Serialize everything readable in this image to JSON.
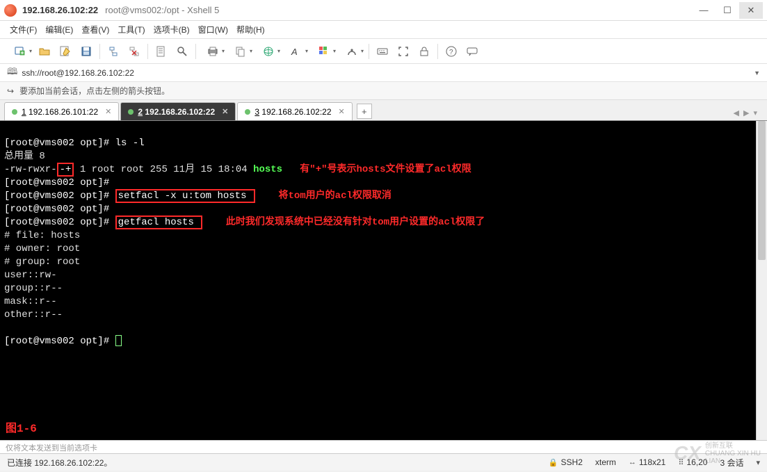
{
  "title": {
    "host": "192.168.26.102:22",
    "rest": "root@vms002:/opt - Xshell 5"
  },
  "menu": {
    "file": "文件(F)",
    "edit": "编辑(E)",
    "view": "查看(V)",
    "tools": "工具(T)",
    "tabs": "选项卡(B)",
    "window": "窗口(W)",
    "help": "帮助(H)"
  },
  "address": {
    "url": "ssh://root@192.168.26.102:22"
  },
  "hint": "要添加当前会话，点击左侧的箭头按钮。",
  "tabs": [
    {
      "idx": "1",
      "label": "192.168.26.101:22"
    },
    {
      "idx": "2",
      "label": "192.168.26.102:22"
    },
    {
      "idx": "3",
      "label": "192.168.26.102:22"
    }
  ],
  "terminal": {
    "line01_prompt": "[root@vms002 opt]#",
    "line01_cmd": " ls -l",
    "line02": "总用量 8",
    "line03a": "-rw-rwxr-",
    "line03_plus": "-+",
    "line03b": " 1 root root 255 11月 15 18:04 ",
    "line03_file": "hosts",
    "line03_ann": "   有\"+\"号表示hosts文件设置了acl权限",
    "line04_prompt": "[root@vms002 opt]#",
    "line05_prompt": "[root@vms002 opt]# ",
    "line05_cmd": "setfacl -x u:tom hosts ",
    "line05_ann": "    将tom用户的acl权限取消",
    "line06_prompt": "[root@vms002 opt]#",
    "line07_prompt": "[root@vms002 opt]# ",
    "line07_cmd": "getfacl hosts ",
    "line07_ann": "    此时我们发现系统中已经没有针对tom用户设置的acl权限了",
    "line08": "# file: hosts",
    "line09": "# owner: root",
    "line10": "# group: root",
    "line11": "user::rw-",
    "line12": "group::r--",
    "line13": "mask::r--",
    "line14": "other::r--",
    "line15": "",
    "line16_prompt": "[root@vms002 opt]# ",
    "figure": "图1-6"
  },
  "inputbar_placeholder": "仅将文本发送到当前选项卡",
  "status": {
    "conn": "已连接 192.168.26.102:22。",
    "proto": "SSH2",
    "term": "xterm",
    "size": "118x21",
    "pos": "16,20",
    "sess": "3 会话"
  },
  "watermark": {
    "brand": "创新互联",
    "sub": "CHUANG XIN HU LIAN"
  }
}
